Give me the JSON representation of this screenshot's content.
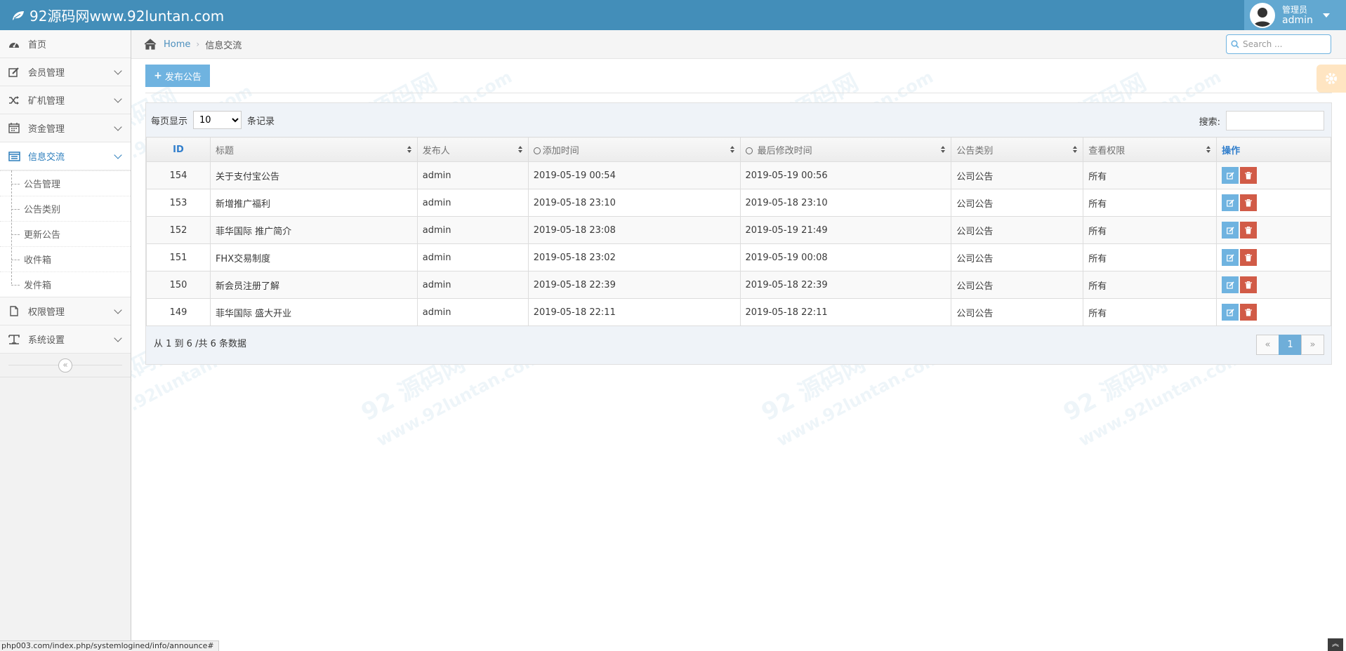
{
  "navbar": {
    "brand": "92源码网www.92luntan.com",
    "user_role": "管理员",
    "user_name": "admin"
  },
  "sidebar": {
    "items": [
      {
        "label": "首页",
        "icon": "dashboard-icon"
      },
      {
        "label": "会员管理",
        "icon": "edit-icon"
      },
      {
        "label": "矿机管理",
        "icon": "random-icon"
      },
      {
        "label": "资金管理",
        "icon": "calendar-icon"
      },
      {
        "label": "信息交流",
        "icon": "list-icon"
      },
      {
        "label": "权限管理",
        "icon": "file-icon"
      },
      {
        "label": "系统设置",
        "icon": "text-icon"
      }
    ],
    "submenu": [
      "公告管理",
      "公告类别",
      "更新公告",
      "收件箱",
      "发件箱"
    ],
    "collapse": "«"
  },
  "breadcrumbs": {
    "home": "Home",
    "current": "信息交流"
  },
  "search": {
    "placeholder": "Search ..."
  },
  "toolbar": {
    "publish_label": "发布公告"
  },
  "table": {
    "length_prefix": "每页显示",
    "length_value": "10",
    "length_suffix": "条记录",
    "filter_label": "搜索:",
    "columns": [
      "ID",
      "标题",
      "发布人",
      "添加时间",
      "最后修改时间",
      "公告类别",
      "查看权限",
      "操作"
    ],
    "rows": [
      [
        "154",
        "关于支付宝公告",
        "admin",
        "2019-05-19 00:54",
        "2019-05-19 00:56",
        "公司公告",
        "所有"
      ],
      [
        "153",
        "新增推广福利",
        "admin",
        "2019-05-18 23:10",
        "2019-05-18 23:10",
        "公司公告",
        "所有"
      ],
      [
        "152",
        "菲华国际 推广简介",
        "admin",
        "2019-05-18 23:08",
        "2019-05-19 21:49",
        "公司公告",
        "所有"
      ],
      [
        "151",
        "FHX交易制度",
        "admin",
        "2019-05-18 23:02",
        "2019-05-19 00:08",
        "公司公告",
        "所有"
      ],
      [
        "150",
        "新会员注册了解",
        "admin",
        "2019-05-18 22:39",
        "2019-05-18 22:39",
        "公司公告",
        "所有"
      ],
      [
        "149",
        "菲华国际 盛大开业",
        "admin",
        "2019-05-18 22:11",
        "2019-05-18 22:11",
        "公司公告",
        "所有"
      ]
    ],
    "info": "从 1 到 6 /共 6 条数据",
    "pagination": {
      "prev": "«",
      "current": "1",
      "next": "»"
    }
  },
  "status_url": "php003.com/index.php/systemlogined/info/announce#",
  "watermark": {
    "logo": "92 源码网",
    "url": "www.92luntan.com"
  },
  "colors": {
    "navbar": "#438eb9",
    "accent": "#6fb3e0",
    "danger": "#d15b47"
  }
}
